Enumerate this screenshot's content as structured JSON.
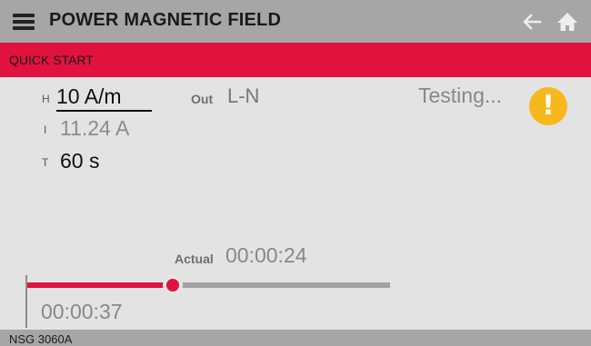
{
  "header": {
    "title": "POWER MAGNETIC FIELD",
    "icons": {
      "menu": "menu-icon",
      "back": "back-arrow-icon",
      "home": "home-icon"
    }
  },
  "mode": {
    "label": "QUICK START"
  },
  "params": {
    "h": {
      "letter": "H",
      "value": "10 A/m"
    },
    "i": {
      "letter": "I",
      "value": "11.24 A"
    },
    "t": {
      "letter": "T",
      "value": "60 s"
    },
    "out": {
      "label": "Out",
      "value": "L-N"
    }
  },
  "status": {
    "text": "Testing...",
    "icon": "warning-icon"
  },
  "progress": {
    "actual_label": "Actual",
    "actual_value": "00:00:24",
    "remaining_value": "00:00:37",
    "fraction": 0.4
  },
  "footer": {
    "device": "NSG 3060A"
  },
  "colors": {
    "accent": "#e1123d",
    "header_bg": "#a6a6a6",
    "screen_bg": "#e3e3e3",
    "warning": "#f7b81b"
  }
}
